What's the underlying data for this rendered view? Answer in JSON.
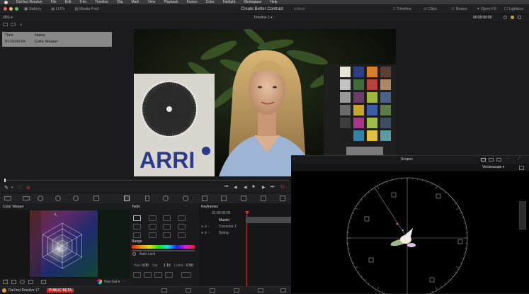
{
  "menubar": {
    "items": [
      "DaVinci Resolve",
      "File",
      "Edit",
      "Trim",
      "Timeline",
      "Clip",
      "Mark",
      "View",
      "Playback",
      "Fusion",
      "Color",
      "Fairlight",
      "Workspace",
      "Help"
    ]
  },
  "toolbar": {
    "gallery": "Gallery",
    "luts": "LUTs",
    "media_pool": "Media Pool",
    "project_title": "Create Better Contrast",
    "project_status": "Edited",
    "timeline": "Timeline",
    "clips": "Clips",
    "nodes": "Nodes",
    "open_fx": "Open FX",
    "lightbox": "Lightbox"
  },
  "viewer": {
    "zoom": "39%",
    "timeline_name": "Timeline 1",
    "timecode": "00:00:00:00"
  },
  "info": {
    "time_label": "Time",
    "name_label": "Name",
    "time_value": "01:00:00:04",
    "name_value": "Color Warper"
  },
  "image": {
    "logo_text": "ARRI"
  },
  "scopes": {
    "title": "Scopes",
    "mode": "Vectorscope"
  },
  "color_warper": {
    "title": "Color Warper",
    "mode": "Hue-Sat"
  },
  "tools": {
    "title": "Tools",
    "range_label": "Range",
    "auto_lock": "Auto Lock",
    "hue_label": "Hue",
    "hue_value": "0.00",
    "sat_label": "Sat",
    "sat_value": "1.16",
    "luma_label": "Luma",
    "luma_value": "0.50"
  },
  "keyframes": {
    "title": "Keyframes",
    "timecode": "01:00:00:00",
    "rows": [
      "Master",
      "Corrector 1",
      "Sizing"
    ]
  },
  "dock": {
    "app_name": "DaVinci Resolve 17",
    "badge": "PUBLIC BETA"
  },
  "colors": {
    "accent_red": "#d03030",
    "playhead": "#d03535"
  }
}
